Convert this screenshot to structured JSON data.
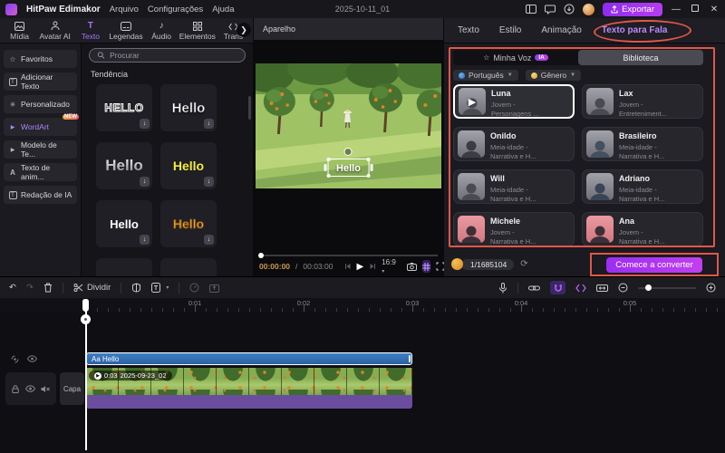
{
  "colors": {
    "accent": "#a62ff0",
    "annotation": "#e05748",
    "text_clip": "#2f6cb3",
    "audio_strip": "#6b4da0",
    "coin": "#e8a33d",
    "active_tab": "#a874f7"
  },
  "titlebar": {
    "app_name": "HitPaw Edimakor",
    "menu_arquivo": "Arquivo",
    "menu_config": "Configurações",
    "menu_ajuda": "Ajuda",
    "project_name": "2025-10-11_01",
    "export_label": "Exportar"
  },
  "media_tabs": {
    "t0": "Mídia",
    "t1": "Avatar AI",
    "t2": "Texto",
    "t3": "Legendas",
    "t4": "Áudio",
    "t5": "Elementos",
    "t6": "Trans"
  },
  "text_sidebar": {
    "i0": "Favoritos",
    "i1": "Adicionar Texto",
    "i2": "Personalizado",
    "i3": "WordArt",
    "badge": "NEW",
    "i4": "Modelo de Te...",
    "i5": "Texto de anim...",
    "i6": "Redação de IA"
  },
  "library": {
    "search_placeholder": "Procurar",
    "section": "Tendência",
    "h0": "HELLO",
    "h1": "Hello",
    "h2": "Hello",
    "h3": "Hello",
    "h4": "Hello",
    "h5": "Hello"
  },
  "preview": {
    "title": "Aparelho",
    "overlay_text": "Hello",
    "current_time": "00:00:00",
    "time_sep": "/",
    "total_time": "00:03:00",
    "aspect": "16:9"
  },
  "inspector": {
    "tab0": "Texto",
    "tab1": "Estilo",
    "tab2": "Animação",
    "tab3": "Texto para Fala",
    "myvoice_label": "Minha Voz",
    "ia_badge": "IA",
    "library_label": "Biblioteca",
    "filter_lang": "Português",
    "filter_gender": "Gênero",
    "voices": [
      {
        "name": "Luna",
        "desc1": "Jovem -",
        "desc2": "Personagens ..."
      },
      {
        "name": "Lax",
        "desc1": "Jovem -",
        "desc2": "Entreteniment..."
      },
      {
        "name": "Onildo",
        "desc1": "Meia-idade -",
        "desc2": "Narrativa e H..."
      },
      {
        "name": "Brasileiro",
        "desc1": "Meia-idade -",
        "desc2": "Narrativa e H..."
      },
      {
        "name": "Will",
        "desc1": "Meia-idade -",
        "desc2": "Narrativa e H..."
      },
      {
        "name": "Adriano",
        "desc1": "Meia-idade -",
        "desc2": "Narrativa e H..."
      },
      {
        "name": "Michele",
        "desc1": "Jovem -",
        "desc2": "Narrativa e H..."
      },
      {
        "name": "Ana",
        "desc1": "Jovem -",
        "desc2": "Narrativa e H..."
      }
    ],
    "credits": "1/1685104",
    "convert_label": "Comece a converter"
  },
  "timeline": {
    "split_label": "Dividir",
    "r0": "0:01",
    "r1": "0:02",
    "r2": "0:03",
    "r3": "0:04",
    "r4": "0:05",
    "text_clip_label": "Aa Hello",
    "video_duration": "0:03",
    "video_name": "2025-09-23_02",
    "cover_label": "Capa"
  }
}
